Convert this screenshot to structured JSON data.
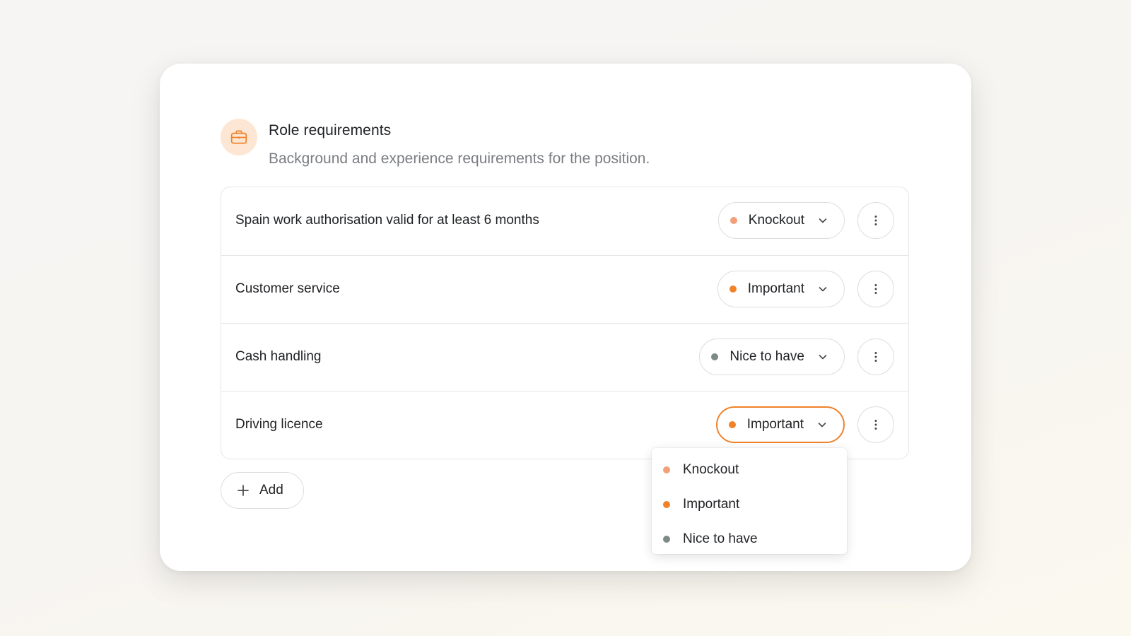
{
  "section": {
    "title": "Role requirements",
    "subtitle": "Background and experience requirements for the position.",
    "icon": "briefcase-icon"
  },
  "colors": {
    "knockout": "#f3a07a",
    "important": "#f0822a",
    "nice_to_have": "#7d8a86",
    "accent": "#f0822a",
    "icon_bg": "#fde6d3"
  },
  "requirements": [
    {
      "label": "Spain work authorisation valid for at least 6 months",
      "priority": "Knockout"
    },
    {
      "label": "Customer service",
      "priority": "Important"
    },
    {
      "label": "Cash handling",
      "priority": "Nice to have"
    },
    {
      "label": "Driving licence",
      "priority": "Important"
    }
  ],
  "add_button": {
    "label": "Add"
  },
  "priority_menu": {
    "open": true,
    "options": [
      "Knockout",
      "Important",
      "Nice to have"
    ]
  }
}
